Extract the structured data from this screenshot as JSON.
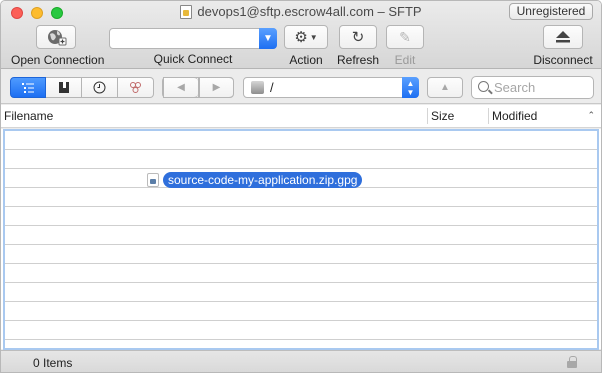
{
  "window": {
    "title": "devops1@sftp.escrow4all.com – SFTP",
    "unregistered_label": "Unregistered"
  },
  "toolbar": {
    "open_connection": {
      "label": "Open Connection",
      "icon": "globe-plus-icon"
    },
    "quick_connect": {
      "label": "Quick Connect",
      "value": "",
      "placeholder": ""
    },
    "action": {
      "label": "Action",
      "icon": "gear-icon"
    },
    "refresh": {
      "label": "Refresh",
      "icon": "refresh-icon"
    },
    "edit": {
      "label": "Edit",
      "icon": "pencil-icon",
      "enabled": false
    },
    "disconnect": {
      "label": "Disconnect",
      "icon": "eject-icon"
    }
  },
  "navbar": {
    "view_modes": [
      "browser",
      "bookmarks",
      "history",
      "bonjour"
    ],
    "active_view": "browser",
    "path": "/",
    "search_placeholder": "Search"
  },
  "columns": [
    {
      "key": "filename",
      "label": "Filename"
    },
    {
      "key": "size",
      "label": "Size"
    },
    {
      "key": "modified",
      "label": "Modified"
    }
  ],
  "dragged_file": {
    "name": "source-code-my-application.zip.gpg"
  },
  "status": {
    "items_text": "0 Items"
  },
  "colors": {
    "accent": "#1d6ff2",
    "drop_highlight": "#a9c9f0"
  }
}
